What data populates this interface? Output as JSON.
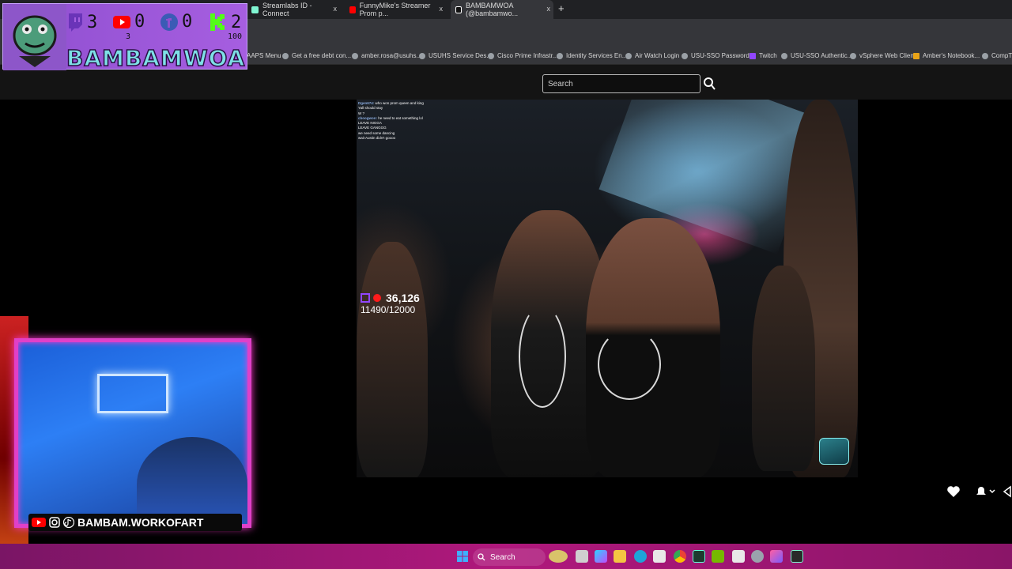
{
  "browser": {
    "tabs": [
      {
        "label": "Streamlabs ID - Connect"
      },
      {
        "label": "FunnyMike's Streamer Prom p..."
      },
      {
        "label": "BAMBAMWOA (@bambamwo..."
      }
    ],
    "new_tab_symbol": "+",
    "close_symbol": "x",
    "bookmarks": [
      "AAPS Menu",
      "Get a free debt con...",
      "amber.rosa@usuhs...",
      "USUHS Service Des...",
      "Cisco Prime Infrastr...",
      "Identity Services En...",
      "Air Watch Login",
      "USU-SSO Password...",
      "Twitch",
      "USU-SSO Authentic...",
      "vSphere Web Client",
      "Amber's Notebook...",
      "CompTIA"
    ]
  },
  "site": {
    "search_placeholder": "Search",
    "search_icon": "magnifier-icon"
  },
  "overlay": {
    "channel_name": "BAMBAMWOA",
    "twitch_count": "3",
    "youtube_count": "0",
    "youtube_sub": "3",
    "facebook_count": "0",
    "kick_count": "2",
    "kick_sub": "100",
    "accent": "#a65ee0"
  },
  "video": {
    "viewer_count": "36,126",
    "goal_text": "11490/12000",
    "chat": [
      {
        "user": "Dgen674:",
        "msg": "who won prom queen and king"
      },
      {
        "user": "",
        "msg": ""
      },
      {
        "user": "",
        "msg": "Yall should stay"
      },
      {
        "user": "",
        "msg": "W ?"
      },
      {
        "user": "cboogwon:",
        "msg": "he need to eat something lol"
      },
      {
        "user": "",
        "msg": "LEAVE NIGGA"
      },
      {
        "user": "",
        "msg": "LEAVE GANGGG"
      },
      {
        "user": "",
        "msg": "we need some dancing"
      },
      {
        "user": "",
        "msg": "wait Austin didn't goooo"
      }
    ]
  },
  "webcam": {
    "handle": "BAMBAM.WORKOFART"
  },
  "taskbar": {
    "search_label": "Search"
  }
}
